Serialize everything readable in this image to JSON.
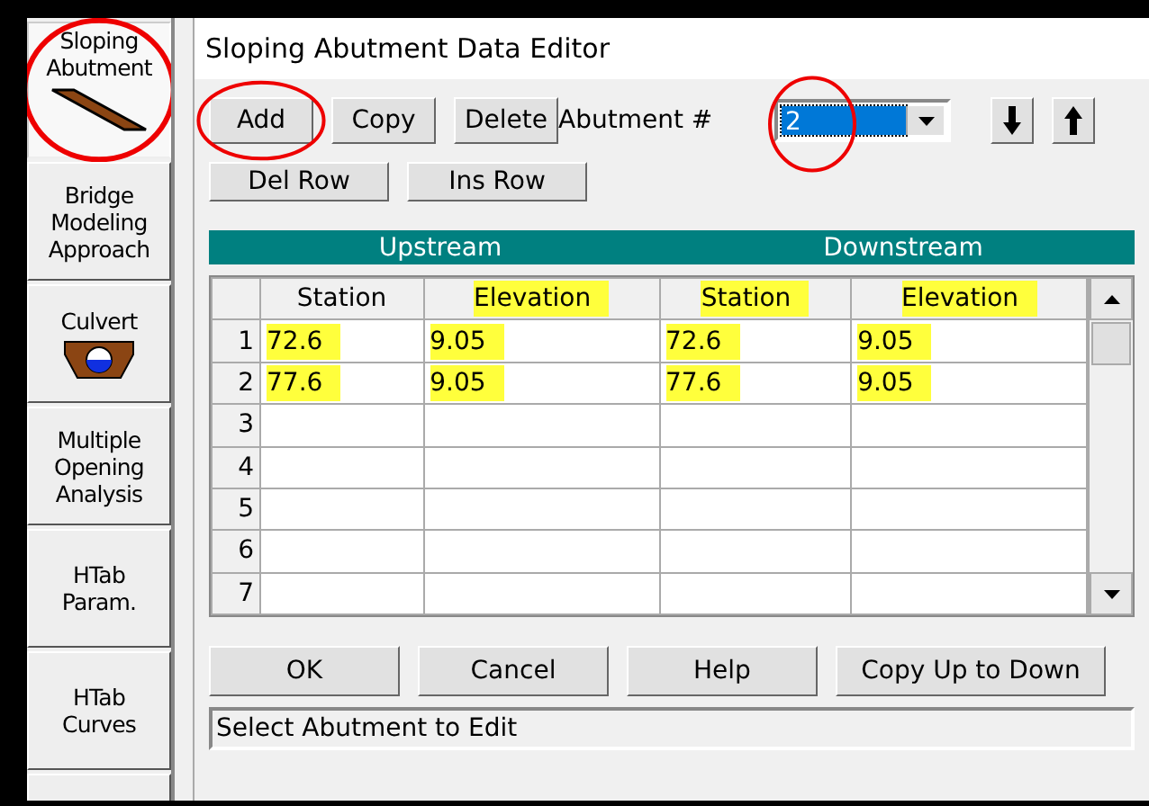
{
  "sidebar": [
    {
      "lines": [
        "Sloping",
        "Abutment"
      ],
      "kind": "abutment",
      "selected": true,
      "circled": true
    },
    {
      "lines": [
        "Bridge",
        "Modeling",
        "Approach"
      ],
      "selected": false,
      "circled": false
    },
    {
      "lines": [
        "Culvert"
      ],
      "kind": "culvert",
      "selected": false,
      "circled": false
    },
    {
      "lines": [
        "Multiple",
        "Opening",
        "Analysis"
      ],
      "selected": false,
      "circled": false
    },
    {
      "lines": [
        "HTab",
        "Param."
      ],
      "selected": false,
      "circled": false
    },
    {
      "lines": [
        "HTab",
        "Curves"
      ],
      "selected": false,
      "circled": false
    }
  ],
  "window": {
    "title": "Sloping Abutment Data Editor"
  },
  "toolbar": {
    "buttons": [
      {
        "label": "Add",
        "circled": true
      },
      {
        "label": "Copy",
        "circled": false
      },
      {
        "label": "Delete",
        "circled": false
      }
    ],
    "abutment_label": "Abutment #",
    "abutment_select": {
      "value": "2",
      "circled": true
    },
    "row_buttons": [
      "Del Row",
      "Ins Row"
    ]
  },
  "table": {
    "groups": [
      "Upstream",
      "Downstream"
    ],
    "columns": [
      {
        "label": "Station",
        "highlighted": false
      },
      {
        "label": "Elevation",
        "highlighted": true
      },
      {
        "label": "Station",
        "highlighted": true
      },
      {
        "label": "Elevation",
        "highlighted": true
      }
    ],
    "rows": [
      {
        "number": "1",
        "cells": [
          {
            "text": "72.6",
            "highlighted": true
          },
          {
            "text": "9.05",
            "highlighted": true
          },
          {
            "text": "72.6",
            "highlighted": true
          },
          {
            "text": "9.05",
            "highlighted": true
          }
        ]
      },
      {
        "number": "2",
        "cells": [
          {
            "text": "77.6",
            "highlighted": true
          },
          {
            "text": "9.05",
            "highlighted": true
          },
          {
            "text": "77.6",
            "highlighted": true
          },
          {
            "text": "9.05",
            "highlighted": true
          }
        ]
      },
      {
        "number": "3"
      },
      {
        "number": "4"
      },
      {
        "number": "5"
      },
      {
        "number": "6"
      },
      {
        "number": "7"
      }
    ]
  },
  "buttons": [
    "OK",
    "Cancel",
    "Help",
    "Copy Up to Down"
  ],
  "status_bar": "Select Abutment to Edit"
}
